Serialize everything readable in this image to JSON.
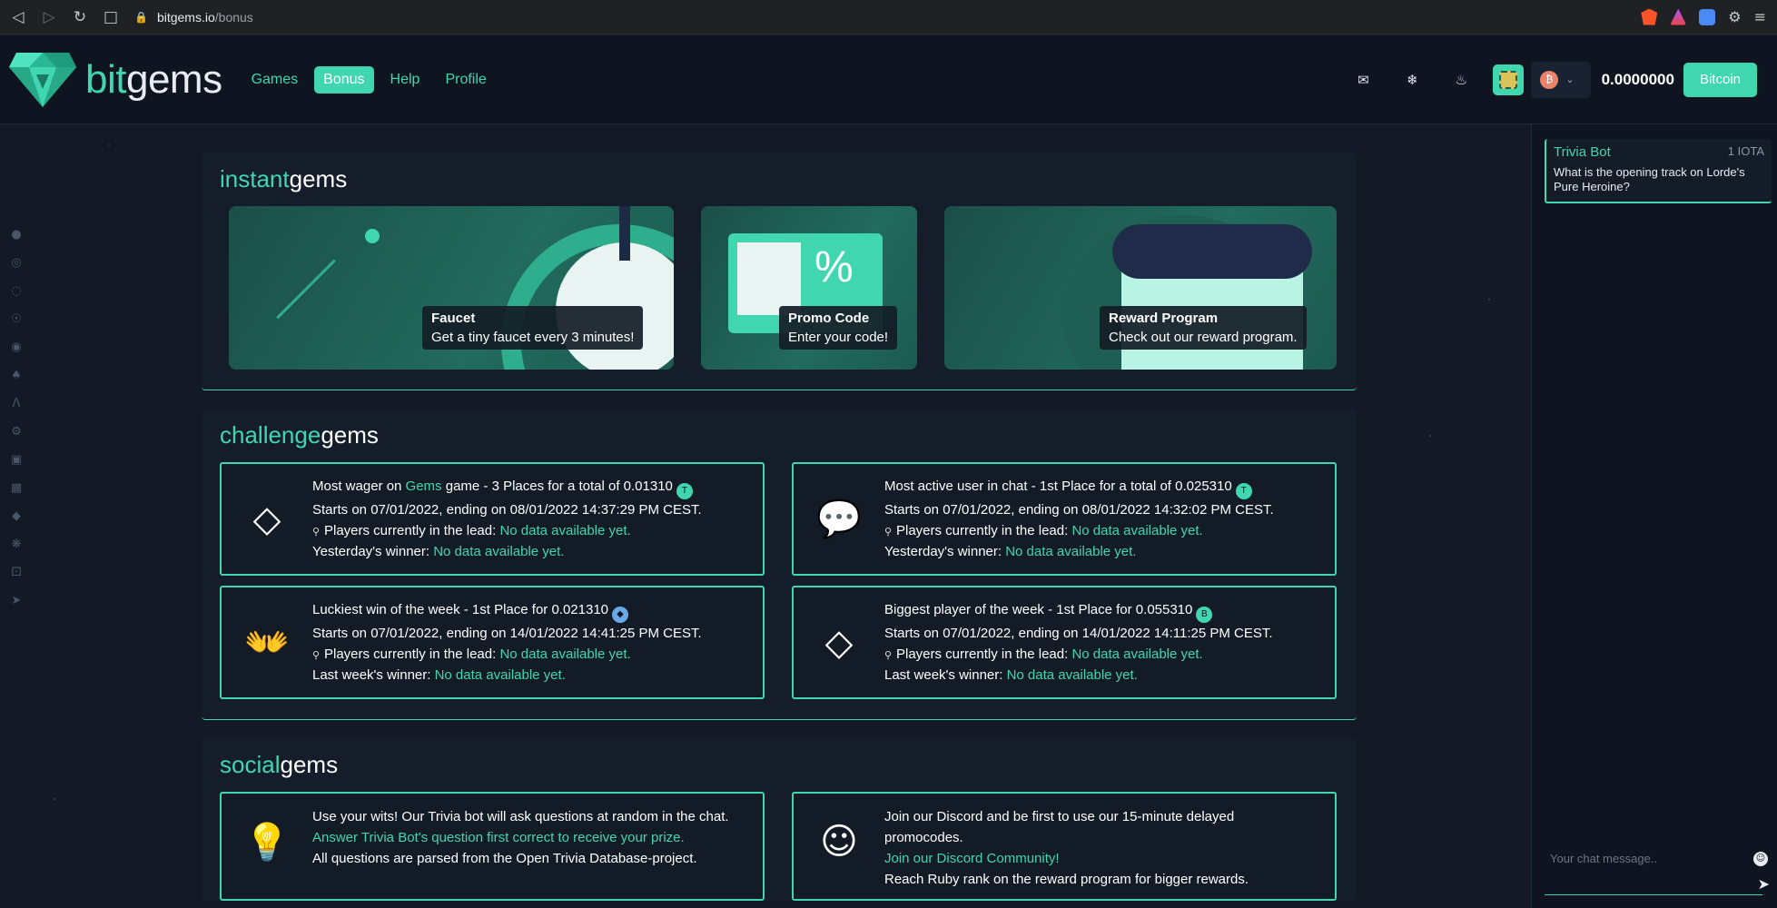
{
  "browser": {
    "url_host": "bitgems.io",
    "url_path": "/bonus"
  },
  "header": {
    "logo_bit": "bit",
    "logo_gems": "gems",
    "nav": [
      {
        "label": "Games",
        "active": false
      },
      {
        "label": "Bonus",
        "active": true
      },
      {
        "label": "Help",
        "active": false
      },
      {
        "label": "Profile",
        "active": false
      }
    ],
    "balance": "0.0000000",
    "currency_button": "Bitcoin",
    "accent_color": "#3fd6b0"
  },
  "instant": {
    "title_a": "instant",
    "title_b": "gems",
    "cards": [
      {
        "title": "Faucet",
        "desc": "Get a tiny faucet every 3 minutes!"
      },
      {
        "title": "Promo Code",
        "desc": "Enter your code!"
      },
      {
        "title": "Reward Program",
        "desc": "Check out our reward program."
      }
    ]
  },
  "challenge": {
    "title_a": "challenge",
    "title_b": "gems",
    "items": [
      {
        "icon": "diamond-icon",
        "line1_prefix": "Most wager on ",
        "line1_link": "Gems",
        "line1_suffix": " game - 3 Places for a total of 0.01310",
        "line2": "Starts on 07/01/2022, ending on 08/01/2022 14:37:29 PM CEST.",
        "lead_label": "Players currently in the lead: ",
        "lead_value": "No data available yet.",
        "winner_label": "Yesterday's winner: ",
        "winner_value": "No data available yet."
      },
      {
        "icon": "chat-dollar-icon",
        "line1_prefix": "Most active user in chat - 1st Place for a total of 0.025310",
        "line1_link": "",
        "line1_suffix": "",
        "line2": "Starts on 07/01/2022, ending on 08/01/2022 14:32:02 PM CEST.",
        "lead_label": "Players currently in the lead: ",
        "lead_value": "No data available yet.",
        "winner_label": "Yesterday's winner: ",
        "winner_value": "No data available yet."
      },
      {
        "icon": "hands-dollar-icon",
        "line1_prefix": "Luckiest win of the week - 1st Place for 0.021310",
        "line1_link": "",
        "line1_suffix": "",
        "line2": "Starts on 07/01/2022, ending on 14/01/2022 14:41:25 PM CEST.",
        "lead_label": "Players currently in the lead: ",
        "lead_value": "No data available yet.",
        "winner_label": "Last week's winner: ",
        "winner_value": "No data available yet."
      },
      {
        "icon": "diamond-icon",
        "line1_prefix": "Biggest player of the week - 1st Place for 0.055310",
        "line1_link": "",
        "line1_suffix": "",
        "line2": "Starts on 07/01/2022, ending on 14/01/2022 14:11:25 PM CEST.",
        "lead_label": "Players currently in the lead: ",
        "lead_value": "No data available yet.",
        "winner_label": "Last week's winner: ",
        "winner_value": "No data available yet."
      }
    ]
  },
  "social": {
    "title_a": "social",
    "title_b": "gems",
    "trivia": {
      "line1": "Use your wits! Our Trivia bot will ask questions at random in the chat.",
      "link": "Answer Trivia Bot's question first correct to receive your prize.",
      "line3": "All questions are parsed from the Open Trivia Database-project."
    },
    "discord": {
      "line1": "Join our Discord and be first to use our 15-minute delayed promocodes.",
      "link": "Join our Discord Community!",
      "line3": "Reach Ruby rank on the reward program for bigger rewards."
    }
  },
  "chat": {
    "messages": [
      {
        "author": "Trivia Bot",
        "amount": "1 IOTA",
        "text": "What is the opening track on Lorde's Pure Heroine?"
      }
    ],
    "input_placeholder": "Your chat message.."
  }
}
